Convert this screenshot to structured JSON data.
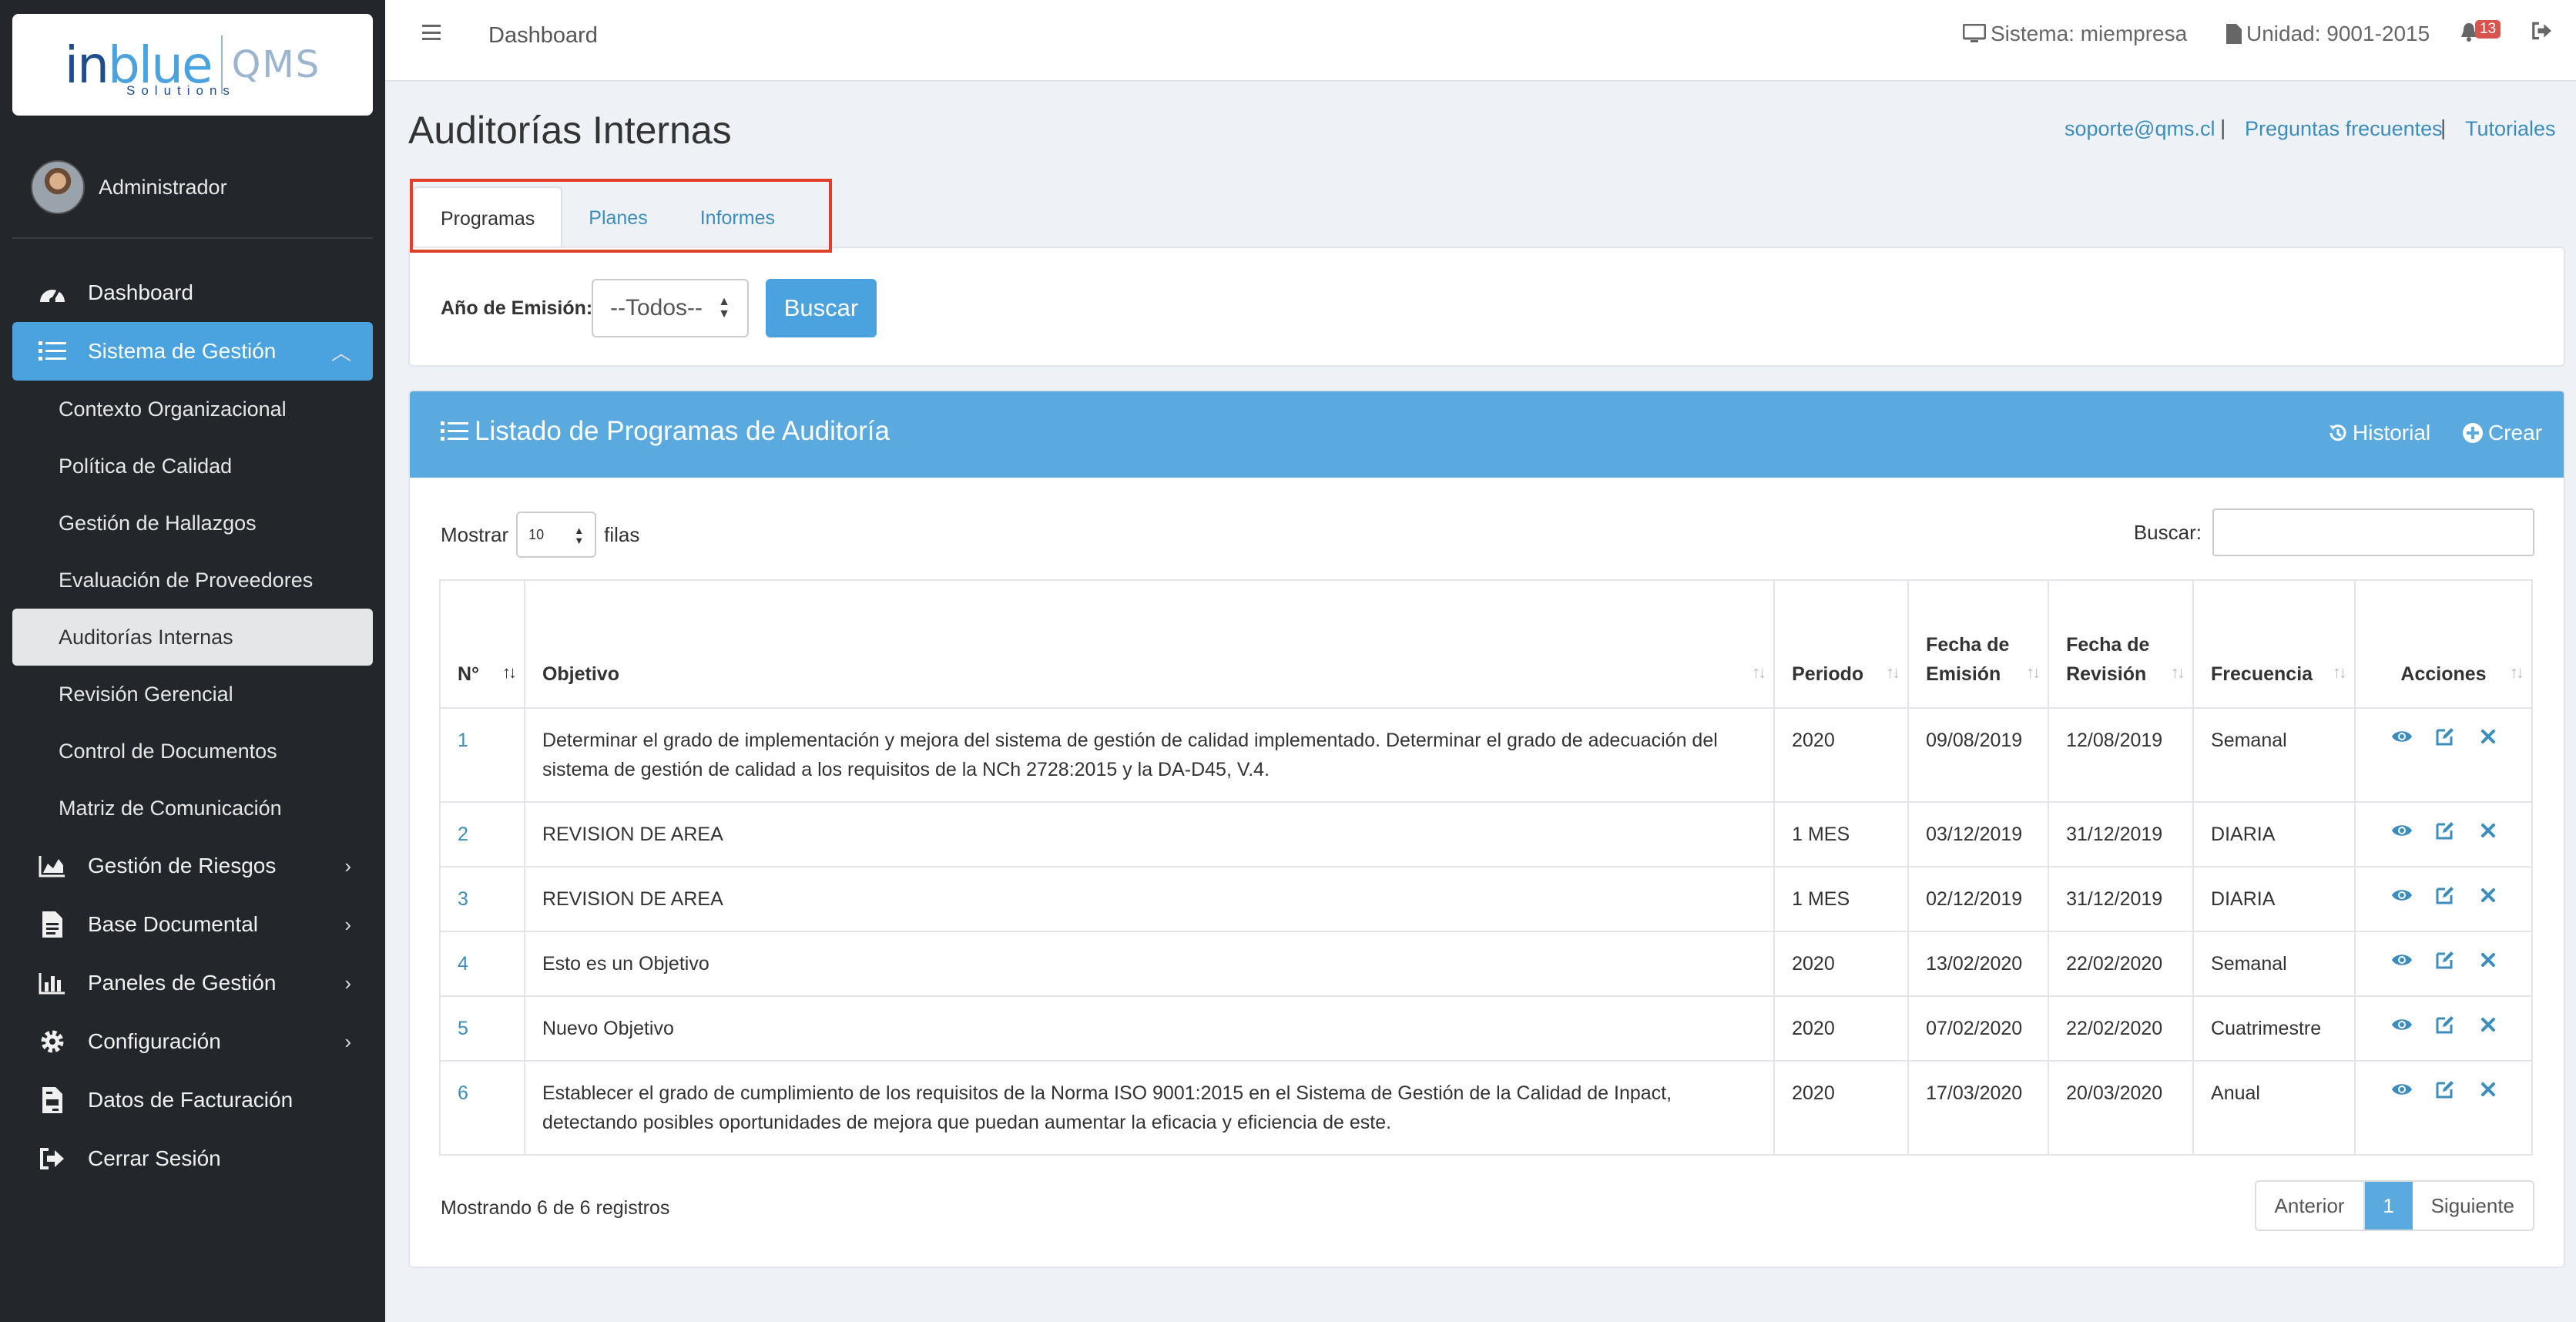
{
  "brand": {
    "logo_in": "in",
    "logo_blue": "blue",
    "logo_qms": "QMS",
    "logo_sub": "Solutions"
  },
  "user": {
    "name": "Administrador"
  },
  "sidebar": {
    "items": [
      {
        "label": "Dashboard",
        "icon": "dashboard-icon"
      },
      {
        "label": "Sistema de Gestión",
        "icon": "list-icon",
        "active": true
      },
      {
        "label": "Gestión de Riesgos",
        "icon": "area-chart-icon"
      },
      {
        "label": "Base Documental",
        "icon": "file-icon"
      },
      {
        "label": "Paneles de Gestión",
        "icon": "bar-chart-icon"
      },
      {
        "label": "Configuración",
        "icon": "gear-icon"
      },
      {
        "label": "Datos de Facturación",
        "icon": "invoice-icon"
      },
      {
        "label": "Cerrar Sesión",
        "icon": "sign-out-icon"
      }
    ],
    "subitems": [
      "Contexto Organizacional",
      "Política de Calidad",
      "Gestión de Hallazgos",
      "Evaluación de Proveedores",
      "Auditorías Internas",
      "Revisión Gerencial",
      "Control de Documentos",
      "Matriz de Comunicación"
    ]
  },
  "topbar": {
    "title": "Dashboard",
    "sistema": "Sistema: miempresa",
    "unidad": "Unidad: 9001-2015",
    "notifications": "13"
  },
  "page": {
    "title": "Auditorías Internas",
    "links": [
      "soporte@qms.cl",
      "Preguntas frecuentes",
      "Tutoriales"
    ],
    "link_sep": "|"
  },
  "tabs": [
    "Programas",
    "Planes",
    "Informes"
  ],
  "filter": {
    "label": "Año de Emisión:",
    "value": "--Todos--",
    "button": "Buscar"
  },
  "panel": {
    "title": "Listado de Programas de Auditoría",
    "historial": "Historial",
    "crear": "Crear",
    "show_label": "Mostrar",
    "show_value": "10",
    "rows_label": "filas",
    "search_label": "Buscar:",
    "footer": "Mostrando 6 de 6 registros",
    "pager": {
      "prev": "Anterior",
      "current": "1",
      "next": "Siguiente"
    }
  },
  "table": {
    "headers": [
      "N°",
      "Objetivo",
      "Periodo",
      "Fecha de Emisión",
      "Fecha de Revisión",
      "Frecuencia",
      "Acciones"
    ],
    "rows": [
      {
        "n": "1",
        "objetivo": "Determinar el grado de implementación y mejora del sistema de gestión de calidad implementado. Determinar el grado de adecuación del sistema de gestión de calidad a los requisitos de la NCh 2728:2015 y la DA-D45, V.4.",
        "periodo": "2020",
        "emision": "09/08/2019",
        "revision": "12/08/2019",
        "frecuencia": "Semanal"
      },
      {
        "n": "2",
        "objetivo": "REVISION DE AREA",
        "periodo": "1 MES",
        "emision": "03/12/2019",
        "revision": "31/12/2019",
        "frecuencia": "DIARIA"
      },
      {
        "n": "3",
        "objetivo": "REVISION DE AREA",
        "periodo": "1 MES",
        "emision": "02/12/2019",
        "revision": "31/12/2019",
        "frecuencia": "DIARIA"
      },
      {
        "n": "4",
        "objetivo": "Esto es un Objetivo",
        "periodo": "2020",
        "emision": "13/02/2020",
        "revision": "22/02/2020",
        "frecuencia": "Semanal"
      },
      {
        "n": "5",
        "objetivo": "Nuevo Objetivo",
        "periodo": "2020",
        "emision": "07/02/2020",
        "revision": "22/02/2020",
        "frecuencia": "Cuatrimestre"
      },
      {
        "n": "6",
        "objetivo": "Establecer el grado de cumplimiento de los requisitos de la Norma ISO 9001:2015 en el Sistema de Gestión de la Calidad de Inpact, detectando posibles oportunidades de mejora que puedan aumentar la eficacia y eficiencia de este.",
        "periodo": "2020",
        "emision": "17/03/2020",
        "revision": "20/03/2020",
        "frecuencia": "Anual"
      }
    ]
  },
  "colors": {
    "accent": "#4aa3df",
    "sidebar": "#23262b",
    "highlight": "#e0402a",
    "link": "#3c8dbc"
  }
}
